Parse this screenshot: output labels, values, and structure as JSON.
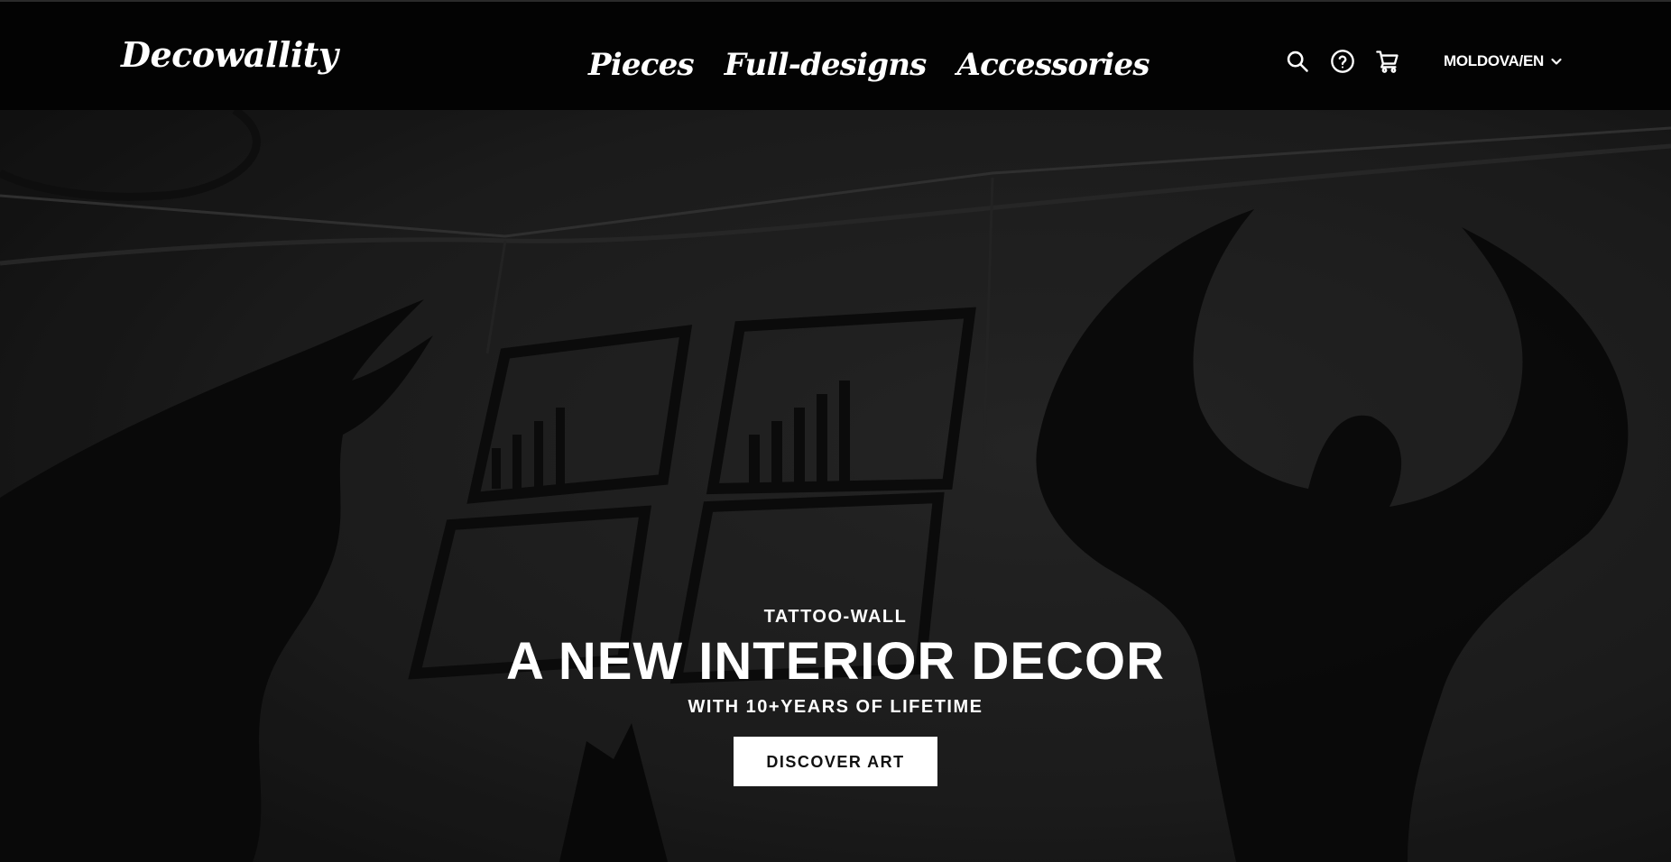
{
  "header": {
    "logo": "Decowallity",
    "nav": [
      {
        "label": "Pieces"
      },
      {
        "label": "Full-designs"
      },
      {
        "label": "Accessories"
      }
    ],
    "icons": [
      "search-icon",
      "help-icon",
      "cart-icon"
    ],
    "locale": "MOLDOVA/EN"
  },
  "hero": {
    "eyebrow": "TATTOO-WALL",
    "headline": "A NEW INTERIOR DECOR",
    "subline": "WITH 10+YEARS OF LIFETIME",
    "cta": "DISCOVER ART"
  },
  "colors": {
    "header_bg": "#030303",
    "text": "#ffffff",
    "cta_bg": "#ffffff",
    "cta_text": "#111111",
    "hero_overlay": "#1b1b1b"
  }
}
